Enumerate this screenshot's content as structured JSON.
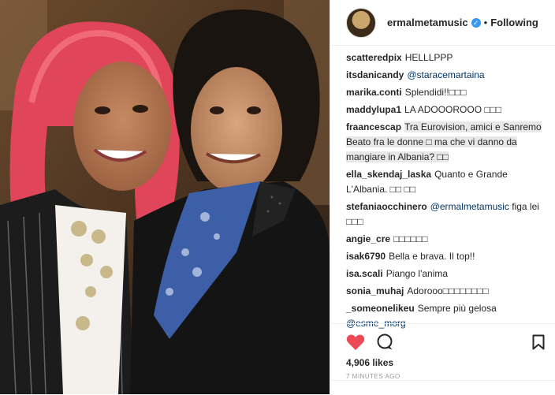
{
  "post": {
    "username": "ermalmetamusic",
    "separator": "•",
    "follow_label": "Following",
    "likes": "4,906 likes",
    "timestamp": "7 MINUTES AGO"
  },
  "comments": [
    {
      "user": "scatteredpix",
      "text": "HELLLPPP"
    },
    {
      "user": "itsdanicandy",
      "mention": "@staracemartaina"
    },
    {
      "user": "marika.conti",
      "text": "Splendidi!!□□□"
    },
    {
      "user": "maddylupa1",
      "text": "LA ADOOOROOO □□□"
    },
    {
      "user": "fraancescap",
      "text": "Tra Eurovision, amici e Sanremo Beato fra le donne □ ma che vi danno da mangiare in Albania? □□"
    },
    {
      "user": "ella_skendaj_laska",
      "text": "Quanto e Grande L'Albania. □□ □□"
    },
    {
      "user": "stefaniaocchinero",
      "mention": "@ermalmetamusic",
      "text_after": "figa lei □□□"
    },
    {
      "user": "angie_cre",
      "text": "□□□□□□"
    },
    {
      "user": "isak6790",
      "text": "Bella e brava. Il top!!"
    },
    {
      "user": "isa.scali",
      "text": "Piango l'anima"
    },
    {
      "user": "sonia_muhaj",
      "text": "Adorooo□□□□□□□□"
    },
    {
      "user": "_someonelikeu",
      "text": "Sempre più gelosa",
      "mention_after": "@esme_morg"
    }
  ],
  "colors": {
    "heart": "#ed4956",
    "verified": "#3897f0",
    "mention": "#003569"
  },
  "icons": [
    "heart-icon",
    "comment-icon",
    "bookmark-icon",
    "verified-icon"
  ]
}
